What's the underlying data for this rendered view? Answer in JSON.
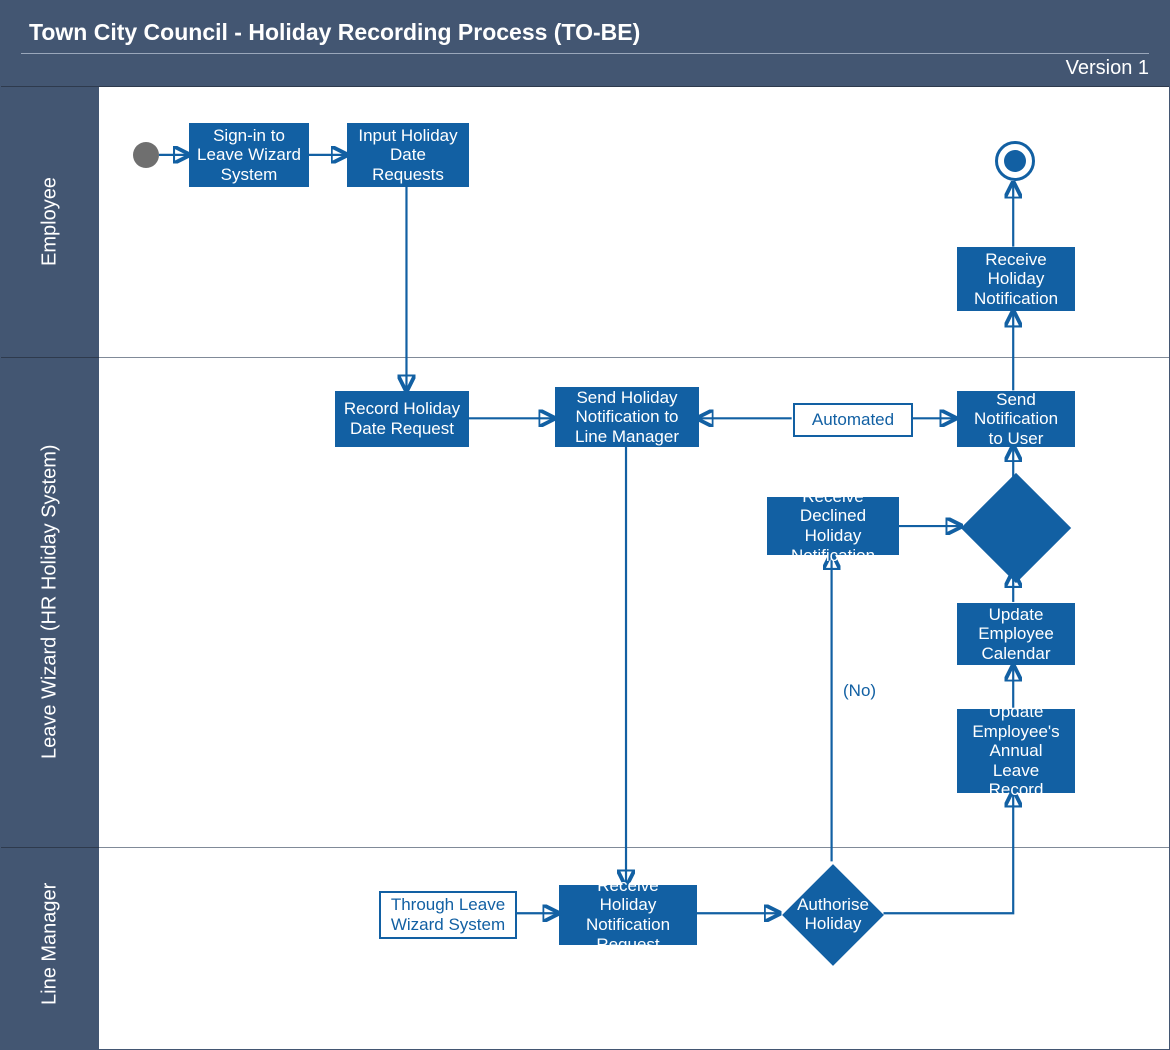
{
  "header": {
    "title": "Town City Council - Holiday Recording Process (TO-BE)",
    "version": "Version 1"
  },
  "lanes": {
    "employee": "Employee",
    "system": "Leave Wizard (HR Holiday System)",
    "manager": "Line Manager"
  },
  "nodes": {
    "signin": "Sign-in to Leave Wizard System",
    "input_dates": "Input Holiday Date Requests",
    "receive_notif": "Receive Holiday Notification",
    "record_request": "Record Holiday Date Request",
    "send_to_mgr": "Send Holiday Notification to Line Manager",
    "automated": "Automated",
    "send_to_user": "Send Notification to User",
    "receive_declined": "Receive Declined Holiday Notification",
    "update_calendar": "Update Employee Calendar",
    "update_record": "Update Employee's Annual Leave Record",
    "through_lws": "Through Leave Wizard System",
    "receive_req": "Receive Holiday Notification Request",
    "authorise": "Authorise Holiday"
  },
  "edge_labels": {
    "no": "(No)"
  }
}
